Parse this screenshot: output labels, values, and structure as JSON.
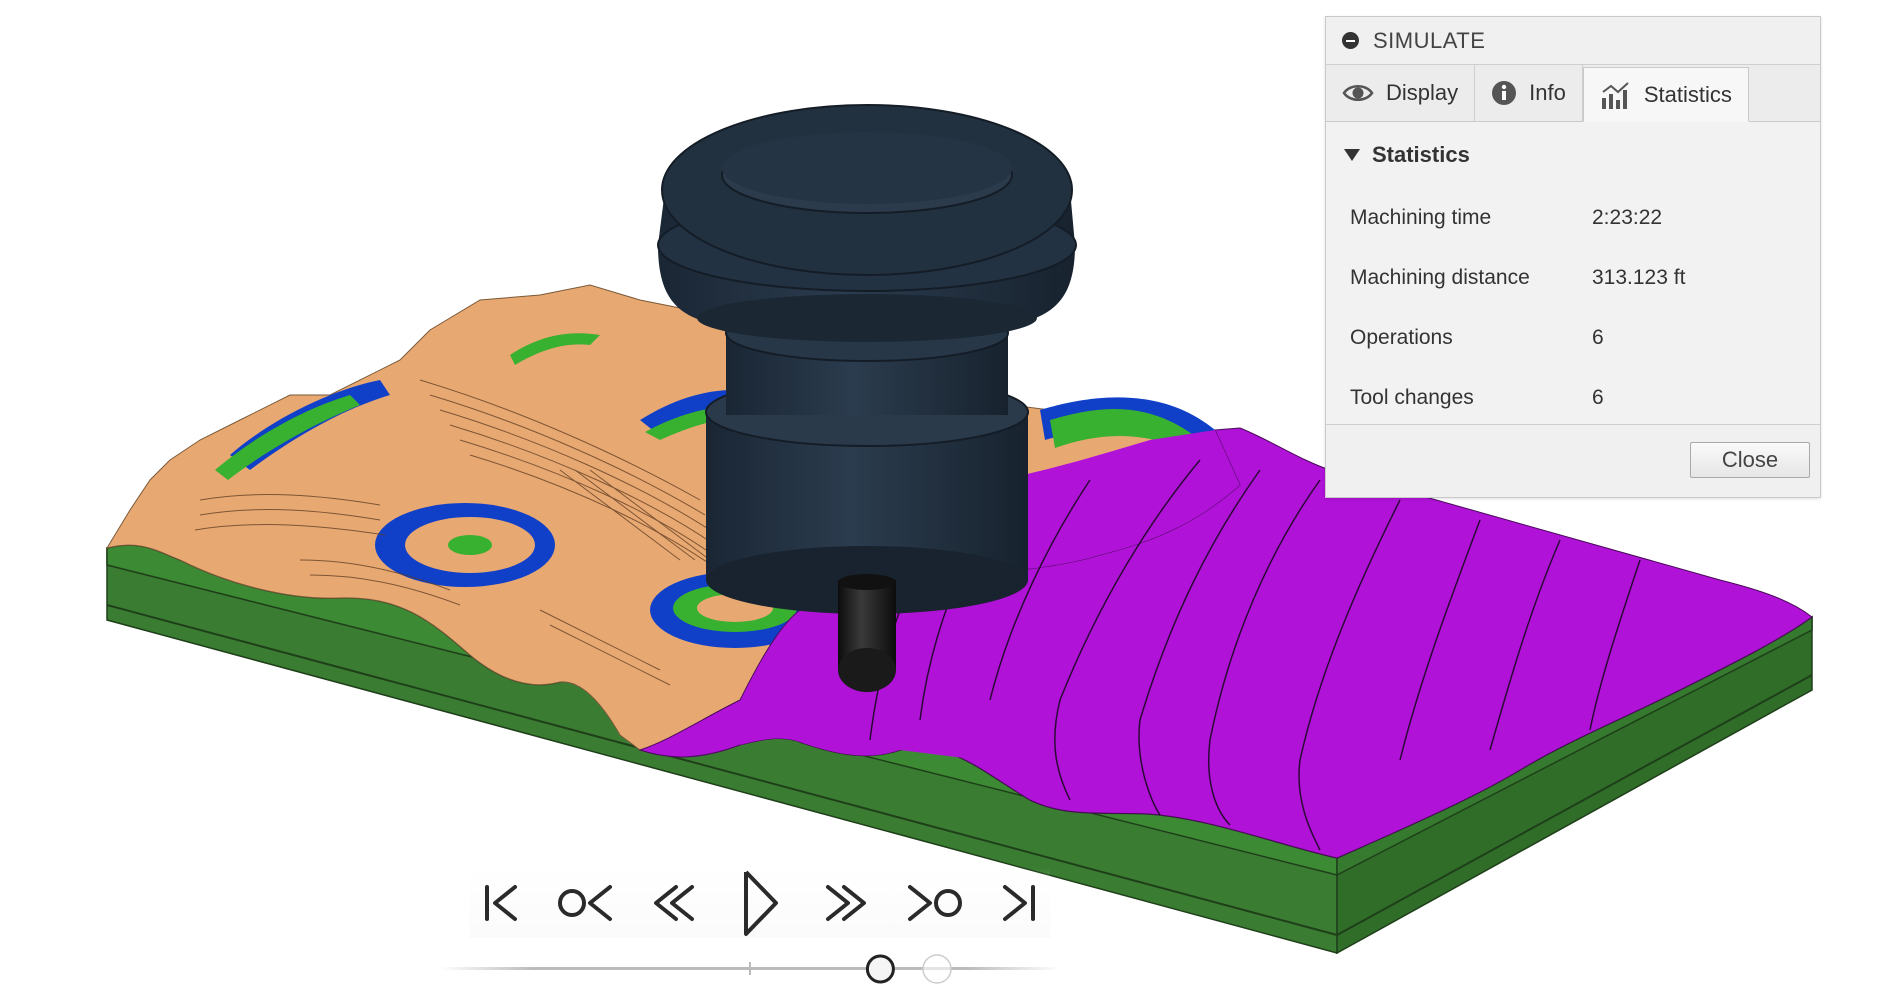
{
  "panel": {
    "title": "SIMULATE",
    "tabs": [
      {
        "label": "Display",
        "icon": "eye-icon"
      },
      {
        "label": "Info",
        "icon": "info-icon"
      },
      {
        "label": "Statistics",
        "icon": "statistics-chart-icon",
        "active": true
      }
    ],
    "section_title": "Statistics",
    "stats": [
      {
        "label": "Machining time",
        "value": "2:23:22"
      },
      {
        "label": "Machining distance",
        "value": "313.123 ft"
      },
      {
        "label": "Operations",
        "value": "6"
      },
      {
        "label": "Tool changes",
        "value": "6"
      }
    ],
    "close_label": "Close"
  },
  "playback": {
    "buttons": [
      {
        "name": "go-to-start",
        "icon": "skip-to-start-icon"
      },
      {
        "name": "previous-operation",
        "icon": "previous-operation-icon"
      },
      {
        "name": "rewind",
        "icon": "rewind-icon"
      },
      {
        "name": "play",
        "icon": "play-icon"
      },
      {
        "name": "fast-forward",
        "icon": "fast-forward-icon"
      },
      {
        "name": "next-operation",
        "icon": "next-operation-icon"
      },
      {
        "name": "go-to-end",
        "icon": "skip-to-end-icon"
      }
    ],
    "progress": 0.72
  },
  "colors": {
    "stock_green": "#3a7d32",
    "uncut_tan": "#e8a872",
    "finished_magenta": "#b012d8",
    "contour_blue": "#1040c8",
    "contour_green": "#38b030",
    "tool_holder": "#1f2f3f",
    "tool_bit": "#1a1a1a"
  }
}
